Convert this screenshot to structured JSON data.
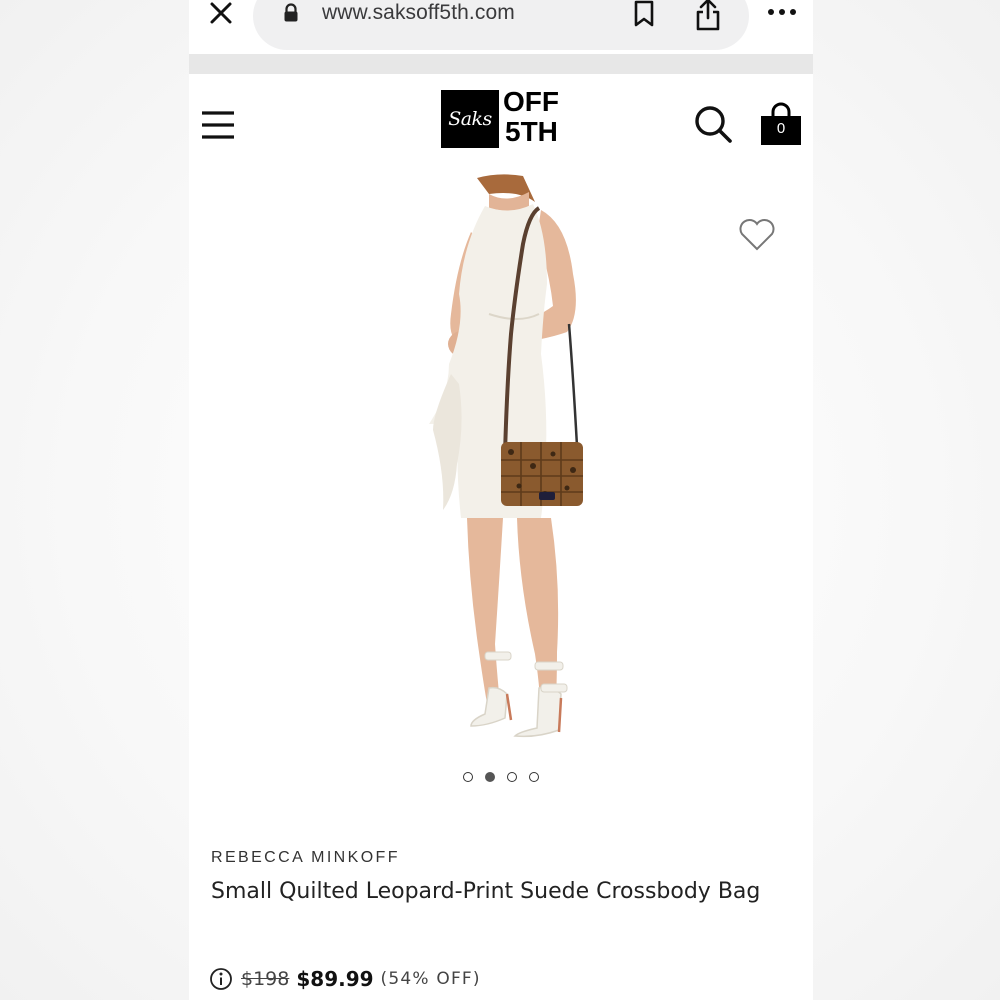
{
  "browser": {
    "url": "www.saksoff5th.com"
  },
  "header": {
    "logo_script": "Saks",
    "logo_line1": "OFF",
    "logo_line2": "5TH",
    "bag_count": "0"
  },
  "gallery": {
    "image_count": 4,
    "active_index": 1
  },
  "product": {
    "brand": "REBECCA MINKOFF",
    "title": "Small Quilted Leopard-Print Suede Crossbody Bag",
    "original_price": "$198",
    "sale_price": "$89.99",
    "discount": "(54% OFF)"
  },
  "colors": {
    "brand_black": "#000000",
    "page_bg": "#ffffff"
  }
}
